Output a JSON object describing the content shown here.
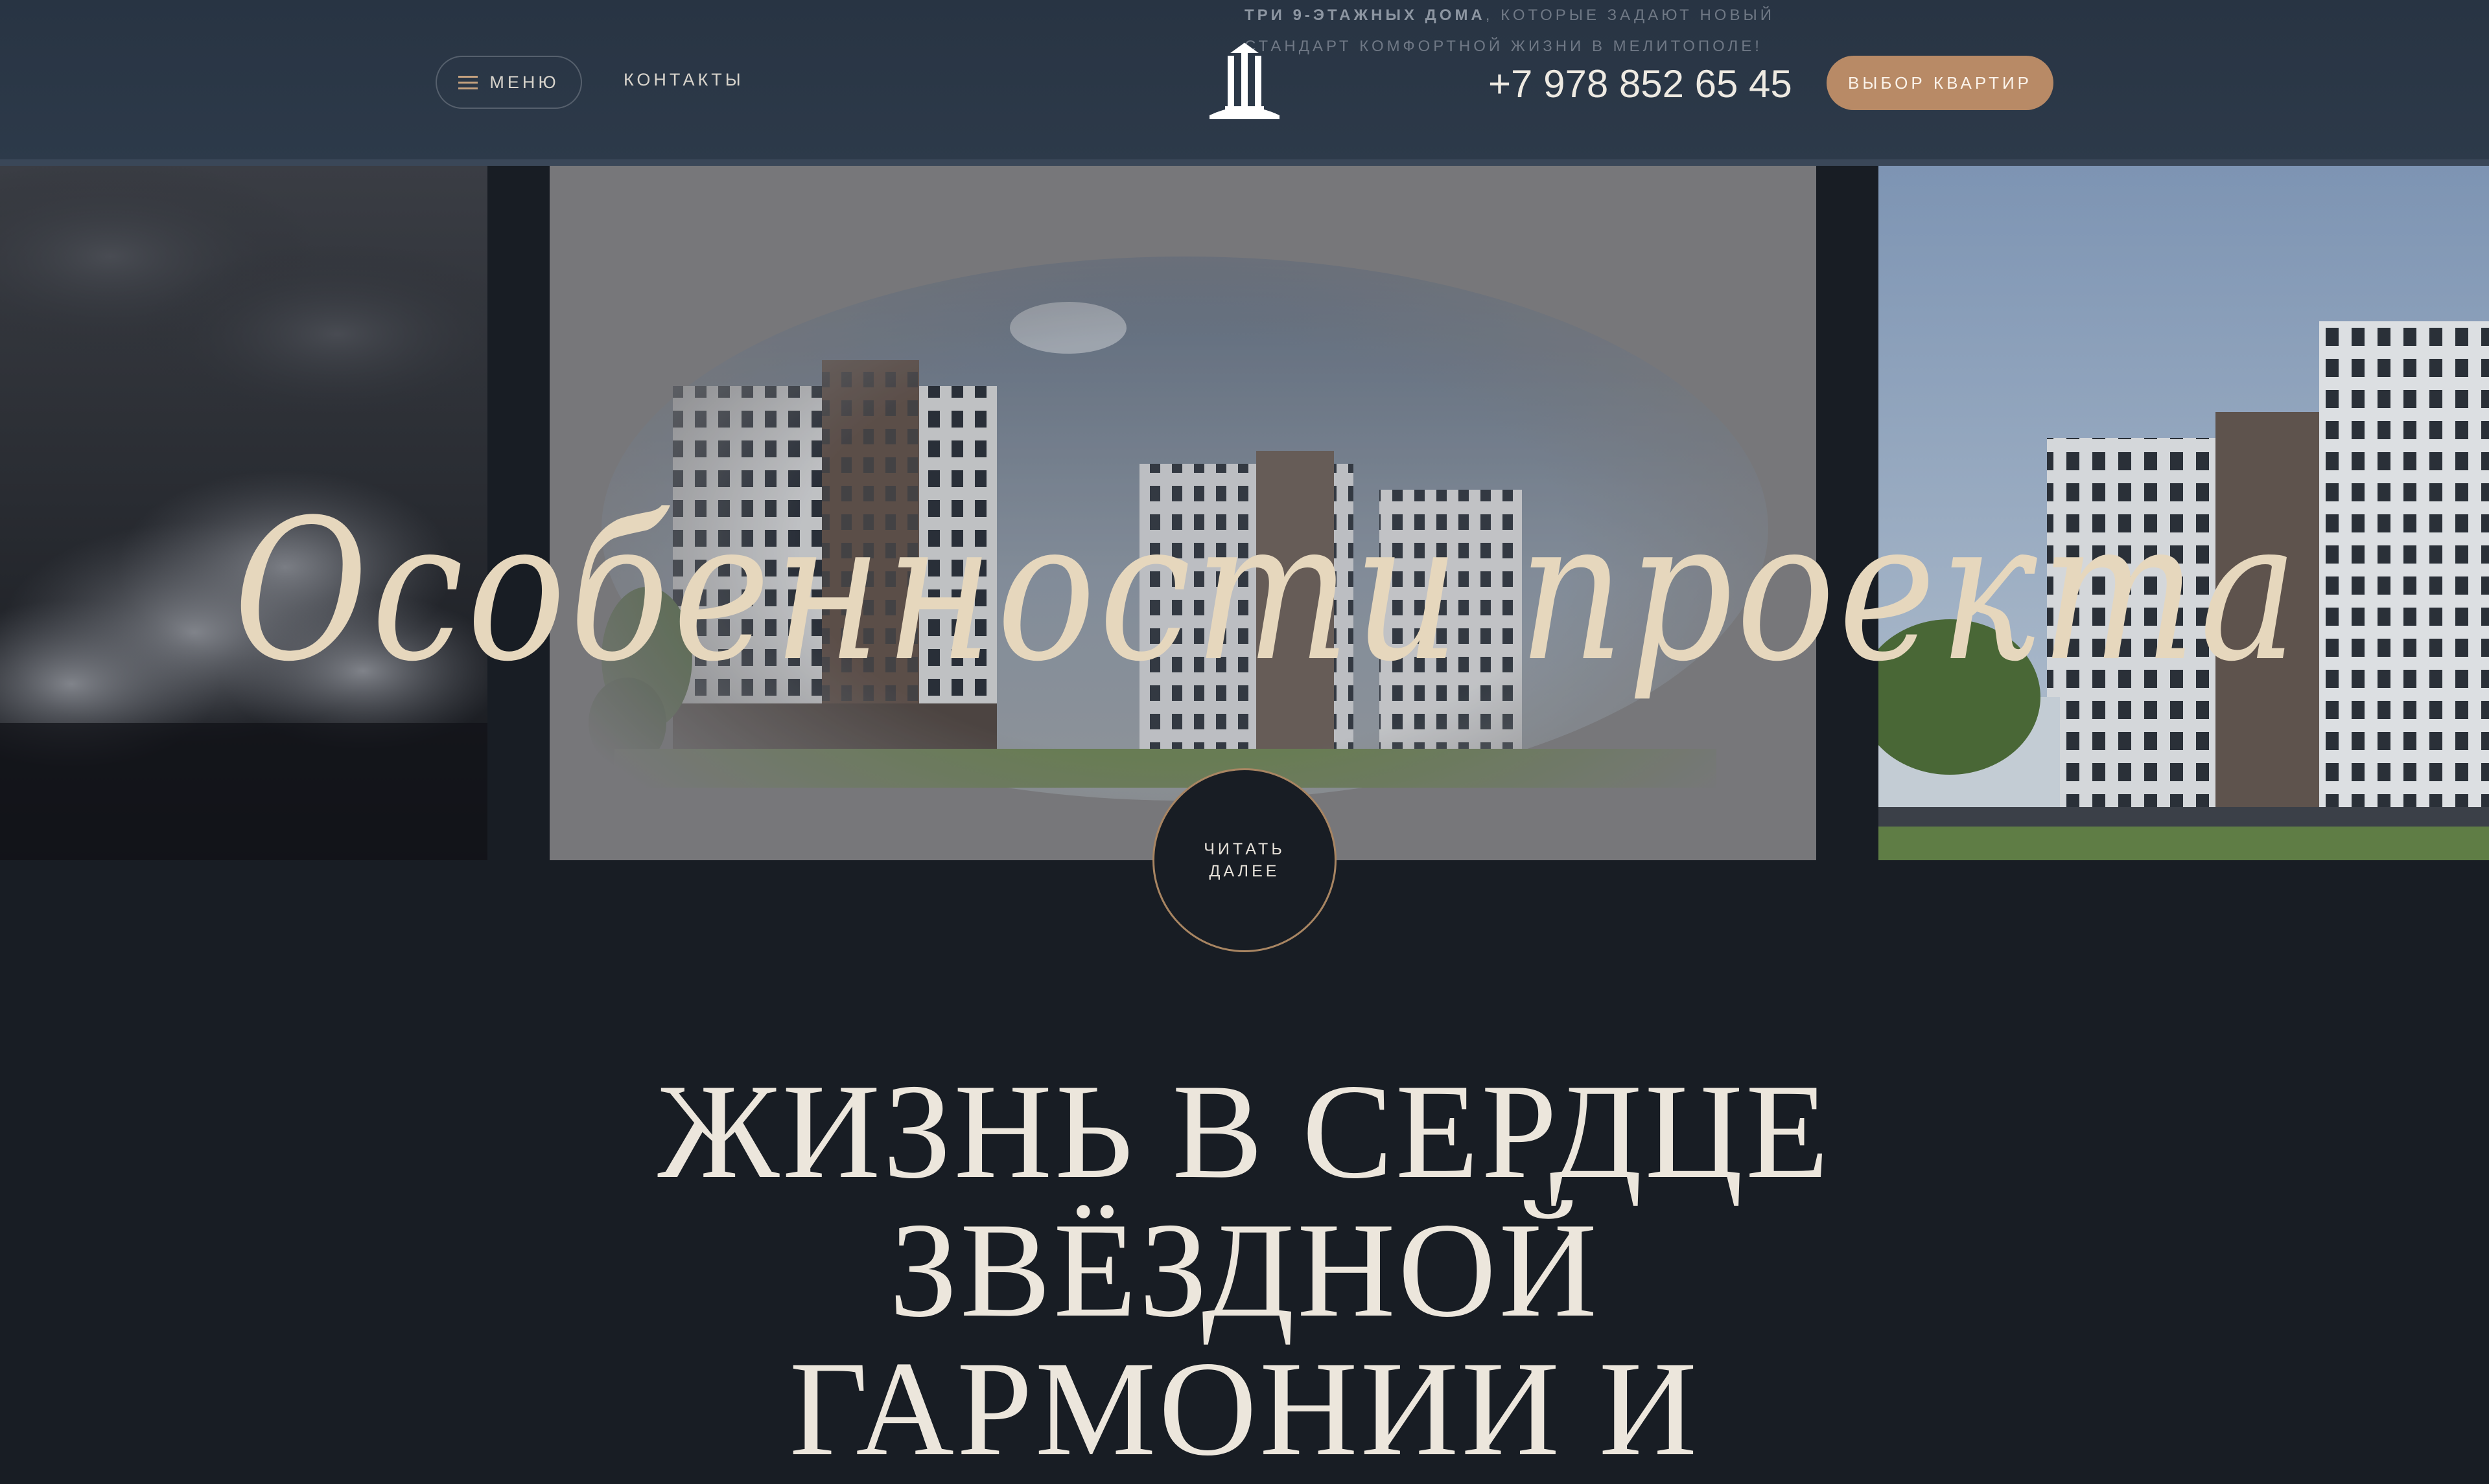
{
  "header": {
    "menu_label": "МЕНЮ",
    "contacts_label": "КОНТАКТЫ",
    "tagline_bold": "ТРИ 9-ЭТАЖНЫХ ДОМА",
    "tagline_rest": ", КОТОРЫЕ ЗАДАЮТ НОВЫЙ",
    "tagline_line2": "СТАНДАРТ КОМФОРТНОЙ ЖИЗНИ В МЕЛИТОПОЛЕ!",
    "phone": "+7 978 852 65 45",
    "cta_label": "ВЫБОР КВАРТИР",
    "logo_icon": "building-logo-icon"
  },
  "hero": {
    "title": "Особенности проекта",
    "read_more_line1": "ЧИТАТЬ",
    "read_more_line2": "ДАЛЕЕ"
  },
  "headline": {
    "line1": "ЖИЗНЬ В СЕРДЦЕ",
    "line2": "ЗВЁЗДНОЙ",
    "line3": "ГАРМОНИИ И"
  },
  "colors": {
    "header_bg": "#2d3a4a",
    "page_bg": "#181d24",
    "accent": "#b88a66",
    "text_light": "#ece6dc",
    "script_title": "#e6d7bd"
  }
}
